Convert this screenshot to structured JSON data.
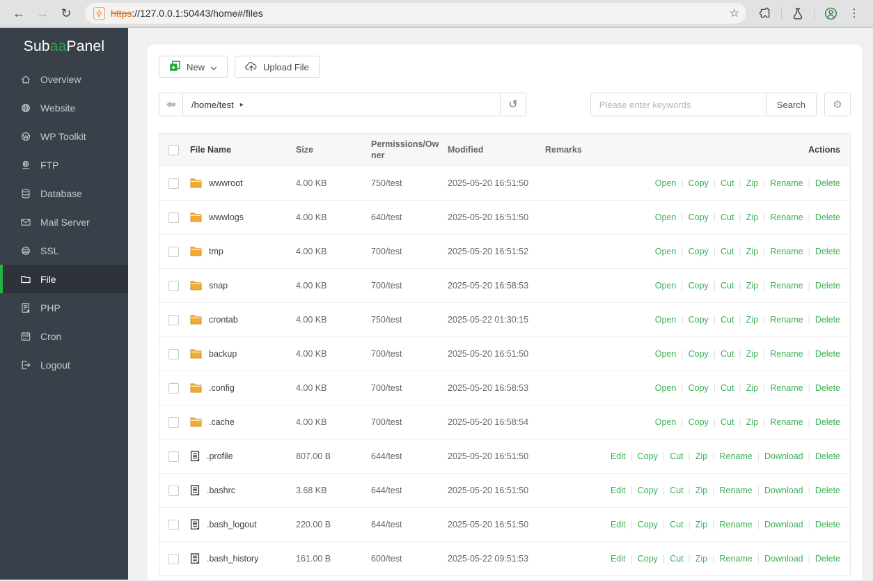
{
  "browser": {
    "url_scheme": "https",
    "url_rest": "://127.0.0.1:50443/home#/files"
  },
  "sidebar": {
    "brand": {
      "prefix": "Sub ",
      "green": "aa",
      "suffix": "Panel"
    },
    "items": [
      {
        "label": "Overview",
        "icon": "home"
      },
      {
        "label": "Website",
        "icon": "globe"
      },
      {
        "label": "WP Toolkit",
        "icon": "wordpress"
      },
      {
        "label": "FTP",
        "icon": "ftp"
      },
      {
        "label": "Database",
        "icon": "database"
      },
      {
        "label": "Mail Server",
        "icon": "mail"
      },
      {
        "label": "SSL",
        "icon": "ssl"
      },
      {
        "label": "File",
        "icon": "folder",
        "active": true
      },
      {
        "label": "PHP",
        "icon": "php"
      },
      {
        "label": "Cron",
        "icon": "cron"
      },
      {
        "label": "Logout",
        "icon": "logout"
      }
    ]
  },
  "toolbar": {
    "new_label": "New",
    "upload_label": "Upload File"
  },
  "pathbar": {
    "path": "/home/test"
  },
  "search": {
    "placeholder": "Please enter keywords",
    "button_label": "Search"
  },
  "table": {
    "headers": [
      "File Name",
      "Size",
      "Permissions/Owner",
      "Modified",
      "Remarks",
      "Actions"
    ],
    "rows": [
      {
        "name": "wwwroot",
        "type": "folder",
        "size": "4.00 KB",
        "permissions": "750/test",
        "modified": "2025-05-20 16:51:50",
        "remarks": "",
        "actions": [
          "Open",
          "Copy",
          "Cut",
          "Zip",
          "Rename",
          "Delete"
        ]
      },
      {
        "name": "wwwlogs",
        "type": "folder",
        "size": "4.00 KB",
        "permissions": "640/test",
        "modified": "2025-05-20 16:51:50",
        "remarks": "",
        "actions": [
          "Open",
          "Copy",
          "Cut",
          "Zip",
          "Rename",
          "Delete"
        ]
      },
      {
        "name": "tmp",
        "type": "folder",
        "size": "4.00 KB",
        "permissions": "700/test",
        "modified": "2025-05-20 16:51:52",
        "remarks": "",
        "actions": [
          "Open",
          "Copy",
          "Cut",
          "Zip",
          "Rename",
          "Delete"
        ]
      },
      {
        "name": "snap",
        "type": "folder",
        "size": "4.00 KB",
        "permissions": "700/test",
        "modified": "2025-05-20 16:58:53",
        "remarks": "",
        "actions": [
          "Open",
          "Copy",
          "Cut",
          "Zip",
          "Rename",
          "Delete"
        ]
      },
      {
        "name": "crontab",
        "type": "folder",
        "size": "4.00 KB",
        "permissions": "750/test",
        "modified": "2025-05-22 01:30:15",
        "remarks": "",
        "actions": [
          "Open",
          "Copy",
          "Cut",
          "Zip",
          "Rename",
          "Delete"
        ]
      },
      {
        "name": "backup",
        "type": "folder",
        "size": "4.00 KB",
        "permissions": "700/test",
        "modified": "2025-05-20 16:51:50",
        "remarks": "",
        "actions": [
          "Open",
          "Copy",
          "Cut",
          "Zip",
          "Rename",
          "Delete"
        ]
      },
      {
        "name": ".config",
        "type": "folder",
        "size": "4.00 KB",
        "permissions": "700/test",
        "modified": "2025-05-20 16:58:53",
        "remarks": "",
        "actions": [
          "Open",
          "Copy",
          "Cut",
          "Zip",
          "Rename",
          "Delete"
        ]
      },
      {
        "name": ".cache",
        "type": "folder",
        "size": "4.00 KB",
        "permissions": "700/test",
        "modified": "2025-05-20 16:58:54",
        "remarks": "",
        "actions": [
          "Open",
          "Copy",
          "Cut",
          "Zip",
          "Rename",
          "Delete"
        ]
      },
      {
        "name": ".profile",
        "type": "file",
        "size": "807.00 B",
        "permissions": "644/test",
        "modified": "2025-05-20 16:51:50",
        "remarks": "",
        "actions": [
          "Edit",
          "Copy",
          "Cut",
          "Zip",
          "Rename",
          "Download",
          "Delete"
        ]
      },
      {
        "name": ".bashrc",
        "type": "file",
        "size": "3.68 KB",
        "permissions": "644/test",
        "modified": "2025-05-20 16:51:50",
        "remarks": "",
        "actions": [
          "Edit",
          "Copy",
          "Cut",
          "Zip",
          "Rename",
          "Download",
          "Delete"
        ]
      },
      {
        "name": ".bash_logout",
        "type": "file",
        "size": "220.00 B",
        "permissions": "644/test",
        "modified": "2025-05-20 16:51:50",
        "remarks": "",
        "actions": [
          "Edit",
          "Copy",
          "Cut",
          "Zip",
          "Rename",
          "Download",
          "Delete"
        ]
      },
      {
        "name": ".bash_history",
        "type": "file",
        "size": "161.00 B",
        "permissions": "600/test",
        "modified": "2025-05-22 09:51:53",
        "remarks": "",
        "actions": [
          "Edit",
          "Copy",
          "Cut",
          "Zip",
          "Rename",
          "Download",
          "Delete"
        ]
      }
    ]
  },
  "colors": {
    "accent_green": "#23b445",
    "brand_green": "#2da44e",
    "link_green": "#3ab054",
    "sidebar_bg": "#3a4049",
    "folder_icon": "#f2ac33",
    "insecure_orange": "#dd6f13"
  }
}
